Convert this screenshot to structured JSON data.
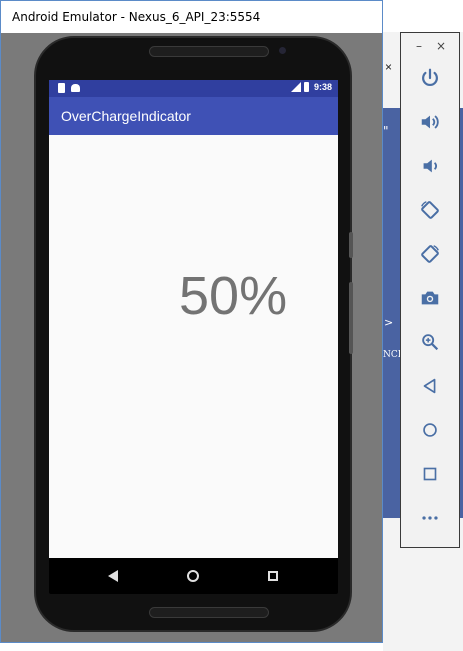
{
  "emulator": {
    "window_title": "Android Emulator - Nexus_6_API_23:5554"
  },
  "phone": {
    "status_time": "9:38",
    "app_title": "OverChargeIndicator",
    "charge_text": "50%"
  },
  "background_window": {
    "close_glyph": "×",
    "quote_glyph": "\"",
    "arrow_glyph": ">",
    "snippet_text": "NCI"
  },
  "toolbar": {
    "minimize_glyph": "–",
    "close_glyph": "×",
    "buttons": [
      "power-icon",
      "volume-up-icon",
      "volume-down-icon",
      "rotate-left-icon",
      "rotate-right-icon",
      "camera-icon",
      "zoom-icon",
      "back-icon",
      "home-icon",
      "overview-icon",
      "more-icon"
    ]
  },
  "colors": {
    "status_bar": "#303f9f",
    "app_bar": "#3f51b5",
    "percent_text": "#737373",
    "toolbar_icon": "#4a6fa5"
  }
}
